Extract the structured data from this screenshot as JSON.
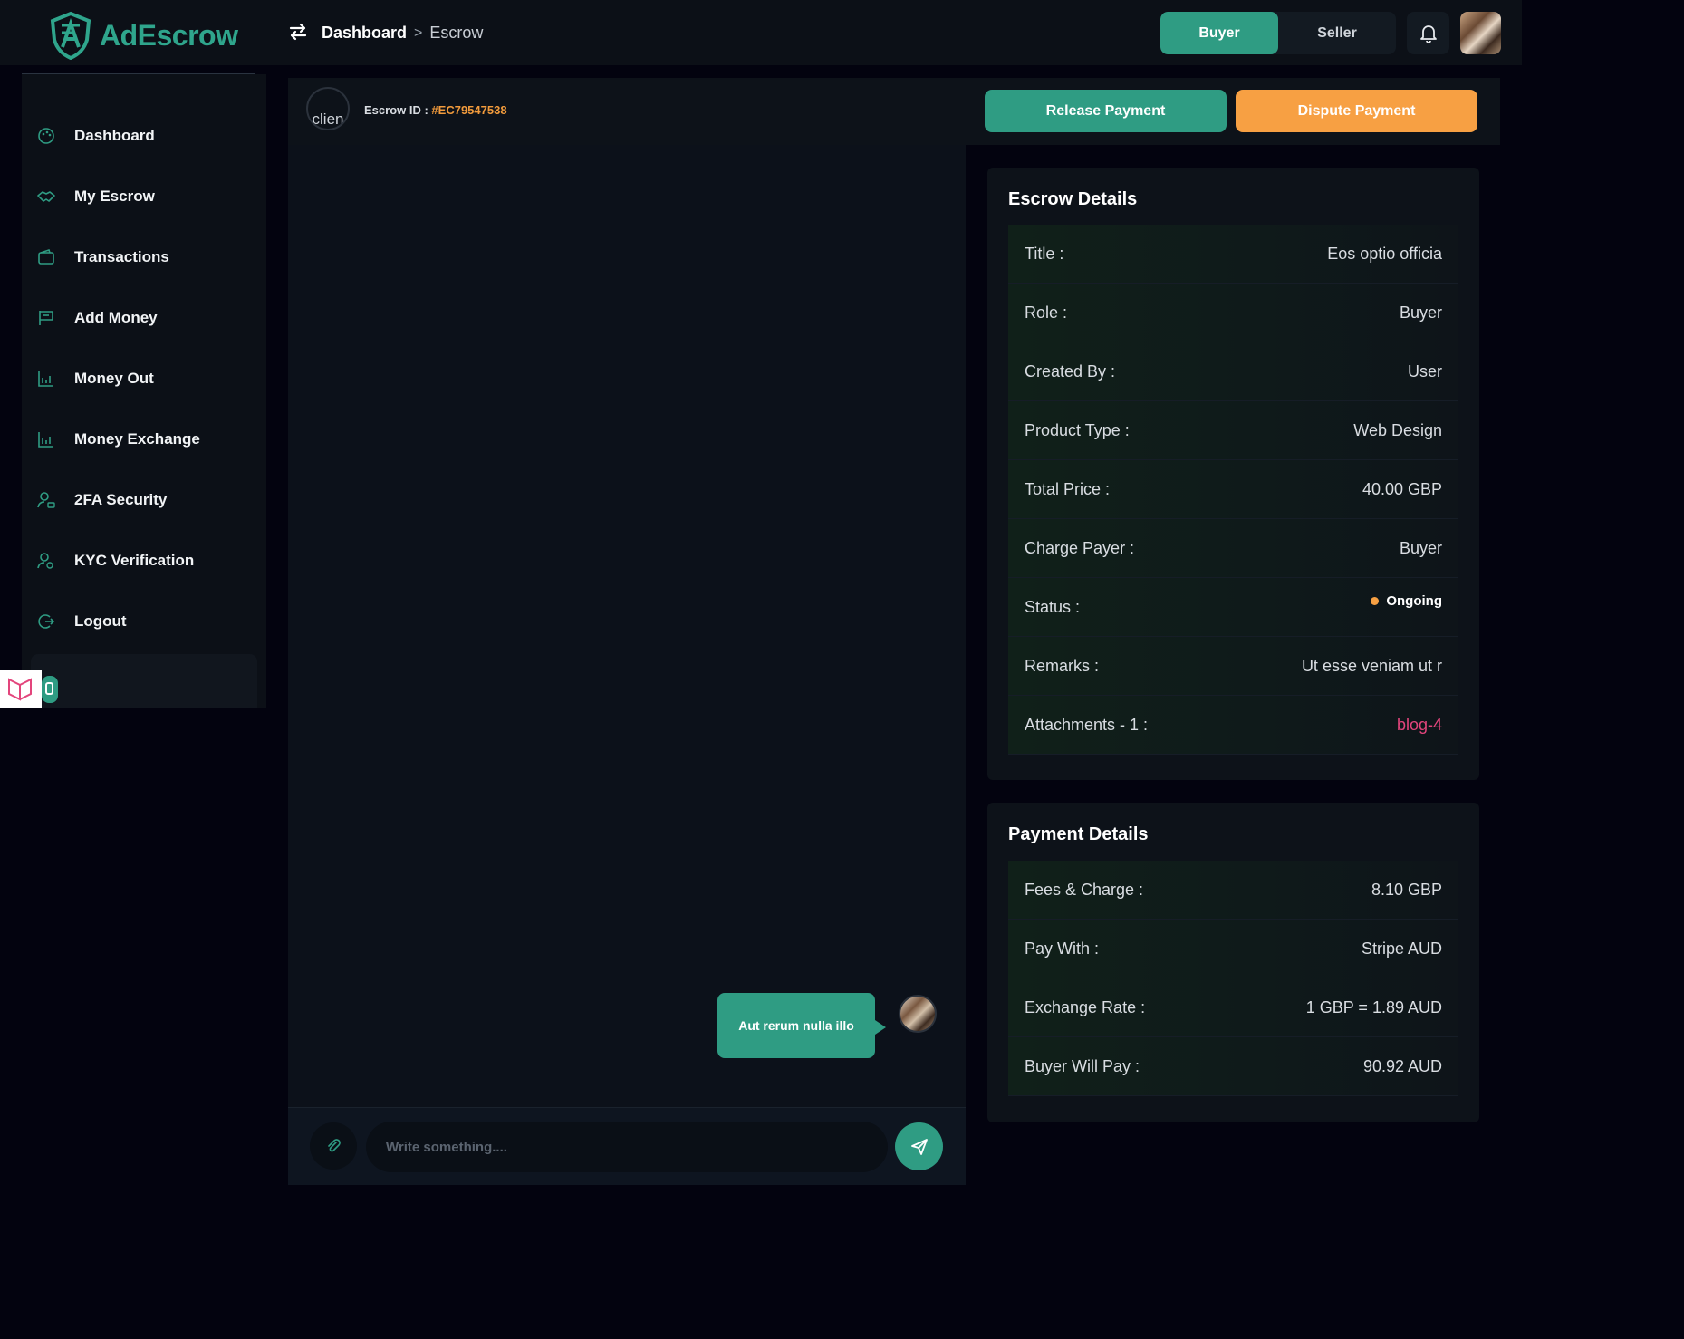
{
  "app": {
    "name": "AdEscrow"
  },
  "breadcrumb": {
    "main": "Dashboard",
    "separator": ">",
    "current": "Escrow"
  },
  "role_toggle": {
    "buyer": "Buyer",
    "seller": "Seller",
    "active": "Buyer"
  },
  "sidebar": {
    "items": [
      {
        "label": "Dashboard",
        "icon": "palette-icon"
      },
      {
        "label": "My Escrow",
        "icon": "handshake-icon"
      },
      {
        "label": "Transactions",
        "icon": "wallet-icon"
      },
      {
        "label": "Add Money",
        "icon": "flag-icon"
      },
      {
        "label": "Money Out",
        "icon": "chart-icon"
      },
      {
        "label": "Money Exchange",
        "icon": "chart-icon"
      },
      {
        "label": "2FA Security",
        "icon": "user-lock-icon"
      },
      {
        "label": "KYC Verification",
        "icon": "user-search-icon"
      },
      {
        "label": "Logout",
        "icon": "logout-icon"
      }
    ]
  },
  "escrow_header": {
    "client_alt": "clien",
    "id_label": "Escrow ID : ",
    "id_value": "#EC79547538",
    "release_label": "Release Payment",
    "dispute_label": "Dispute Payment"
  },
  "chat": {
    "message": "Aut rerum nulla illo",
    "placeholder": "Write something...."
  },
  "escrow_details": {
    "title": "Escrow Details",
    "rows": [
      {
        "key": "Title :",
        "value": "Eos optio officia"
      },
      {
        "key": "Role :",
        "value": "Buyer"
      },
      {
        "key": "Created By :",
        "value": "User"
      },
      {
        "key": "Product Type :",
        "value": "Web Design"
      },
      {
        "key": "Total Price :",
        "value": "40.00 GBP"
      },
      {
        "key": "Charge Payer :",
        "value": "Buyer"
      },
      {
        "key": "Status :",
        "value": "Ongoing"
      },
      {
        "key": "Remarks :",
        "value": "Ut esse veniam ut r"
      },
      {
        "key": "Attachments - 1 :",
        "value": "blog-4"
      }
    ]
  },
  "payment_details": {
    "title": "Payment Details",
    "rows": [
      {
        "key": "Fees & Charge :",
        "value": "8.10 GBP"
      },
      {
        "key": "Pay With :",
        "value": "Stripe AUD"
      },
      {
        "key": "Exchange Rate :",
        "value": "1 GBP = 1.89 AUD"
      },
      {
        "key": "Buyer Will Pay :",
        "value": "90.92 AUD"
      }
    ]
  },
  "colors": {
    "accent": "#2f9c83",
    "warning": "#f7a043",
    "escrow_id": "#f29b3c",
    "link": "#e3457c",
    "background": "#03030f"
  }
}
